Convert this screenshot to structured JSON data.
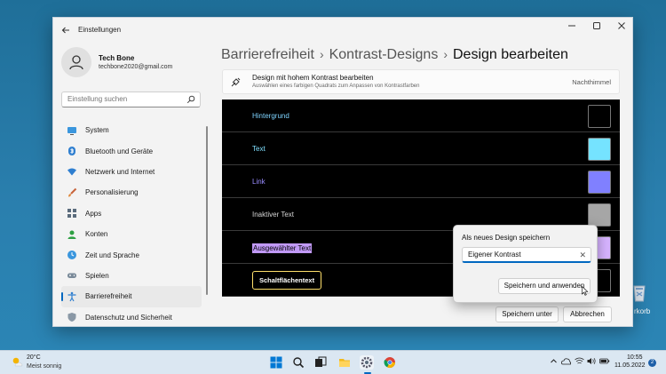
{
  "window": {
    "app_title": "Einstellungen",
    "user": {
      "name": "Tech Bone",
      "email": "techbone2020@gmail.com"
    },
    "search_placeholder": "Einstellung suchen"
  },
  "sidebar": {
    "items": [
      {
        "label": "System",
        "icon": "monitor-icon",
        "active": false
      },
      {
        "label": "Bluetooth und Geräte",
        "icon": "bluetooth-icon",
        "active": false
      },
      {
        "label": "Netzwerk und Internet",
        "icon": "wifi-icon",
        "active": false
      },
      {
        "label": "Personalisierung",
        "icon": "brush-icon",
        "active": false
      },
      {
        "label": "Apps",
        "icon": "apps-icon",
        "active": false
      },
      {
        "label": "Konten",
        "icon": "person-icon",
        "active": false
      },
      {
        "label": "Zeit und Sprache",
        "icon": "globe-clock-icon",
        "active": false
      },
      {
        "label": "Spielen",
        "icon": "gamepad-icon",
        "active": false
      },
      {
        "label": "Barrierefreiheit",
        "icon": "accessibility-icon",
        "active": true
      },
      {
        "label": "Datenschutz und Sicherheit",
        "icon": "shield-icon",
        "active": false
      }
    ]
  },
  "breadcrumb": {
    "items": [
      "Barrierefreiheit",
      "Kontrast-Designs"
    ],
    "current": "Design bearbeiten",
    "separator": "›"
  },
  "editor": {
    "title": "Design mit hohem Kontrast bearbeiten",
    "subtitle": "Auswählen eines farbigen Quadrats zum Anpassen von Kontrastfarben",
    "theme_name": "Nachthimmel",
    "rows": [
      {
        "label": "Hintergrund",
        "label_color": "#7fd4ff",
        "swatch": "#000000"
      },
      {
        "label": "Text",
        "label_color": "#80e0ff",
        "swatch": "#75e3ff"
      },
      {
        "label": "Link",
        "label_color": "#9a8cff",
        "swatch": "#8080ff"
      },
      {
        "label": "Inaktiver Text",
        "label_color": "#d7d7d7",
        "swatch": "#a6a6a6"
      },
      {
        "label": "Ausgewählter Text",
        "label_color": "#000000",
        "swatch": "#d6b3ff"
      },
      {
        "label": "Schaltflächentext",
        "label_color": "#ffffff",
        "swatch": "#000000"
      }
    ],
    "save_as_label": "Speichern unter",
    "cancel_label": "Abbrechen"
  },
  "popup": {
    "title": "Als neues Design speichern",
    "input_value": "Eigener Kontrast",
    "save_apply_label": "Speichern und anwenden"
  },
  "desktop": {
    "recycle_label": "rkorb"
  },
  "taskbar": {
    "weather_temp": "20°C",
    "weather_desc": "Meist sonnig",
    "time": "10:55",
    "date": "11.05.2022",
    "notifications": "2"
  },
  "colors": {
    "accent": "#0067c0",
    "button_border": "#ffe06b",
    "selected_bg": "#c199f7"
  }
}
